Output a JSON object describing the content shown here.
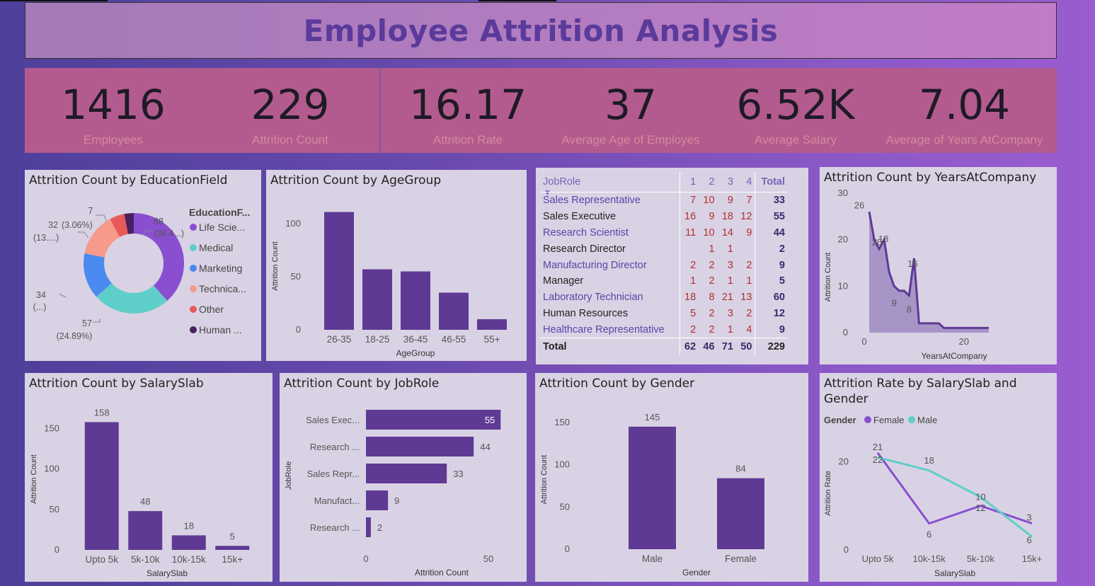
{
  "title": "Employee Attrition Analysis",
  "kpis": [
    {
      "value": "1416",
      "label": "Employees"
    },
    {
      "value": "229",
      "label": "Attrition Count"
    },
    {
      "value": "16.17",
      "label": "Attrition Rate"
    },
    {
      "value": "37",
      "label": "Average Age of Employes"
    },
    {
      "value": "6.52K",
      "label": "Average Salary"
    },
    {
      "value": "7.04",
      "label": "Average of Years AtCompany"
    }
  ],
  "colors": {
    "primary": "#5e3a94",
    "panel_bg": "#d9d2e4",
    "kpi_bg": "#b35b8e",
    "teal": "#5ecfc8",
    "violet": "#8a4fd0"
  },
  "panels": {
    "education": {
      "title": "Attrition Count by EducationField",
      "legend_title": "EducationF..."
    },
    "agegroup": {
      "title": "Attrition Count by AgeGroup"
    },
    "years": {
      "title": "Attrition Count by YearsAtCompany"
    },
    "salaryslab": {
      "title": "Attrition Count by SalarySlab"
    },
    "jobrole": {
      "title": "Attrition Count by JobRole"
    },
    "gender": {
      "title": "Attrition Count by Gender"
    },
    "rate": {
      "title_line1": "Attrition Rate by SalarySlab and",
      "title_line2": "Gender",
      "legend_title": "Gender"
    }
  },
  "matrix": {
    "headers": [
      "JobRole",
      "1",
      "2",
      "3",
      "4",
      "Total"
    ],
    "rows": [
      {
        "role": "Sales Representative",
        "c1": "7",
        "c2": "10",
        "c3": "9",
        "c4": "7",
        "total": "33"
      },
      {
        "role": "Sales Executive",
        "c1": "16",
        "c2": "9",
        "c3": "18",
        "c4": "12",
        "total": "55"
      },
      {
        "role": "Research Scientist",
        "c1": "11",
        "c2": "10",
        "c3": "14",
        "c4": "9",
        "total": "44"
      },
      {
        "role": "Research Director",
        "c1": "",
        "c2": "1",
        "c3": "1",
        "c4": "",
        "total": "2"
      },
      {
        "role": "Manufacturing Director",
        "c1": "2",
        "c2": "2",
        "c3": "3",
        "c4": "2",
        "total": "9"
      },
      {
        "role": "Manager",
        "c1": "1",
        "c2": "2",
        "c3": "1",
        "c4": "1",
        "total": "5"
      },
      {
        "role": "Laboratory Technician",
        "c1": "18",
        "c2": "8",
        "c3": "21",
        "c4": "13",
        "total": "60"
      },
      {
        "role": "Human Resources",
        "c1": "5",
        "c2": "2",
        "c3": "3",
        "c4": "2",
        "total": "12"
      },
      {
        "role": "Healthcare Representative",
        "c1": "2",
        "c2": "2",
        "c3": "1",
        "c4": "4",
        "total": "9"
      }
    ],
    "total_row": {
      "role": "Total",
      "c1": "62",
      "c2": "46",
      "c3": "71",
      "c4": "50",
      "total": "229"
    }
  },
  "chart_data": [
    {
      "type": "pie",
      "title": "Attrition Count by EducationField",
      "legend_title": "EducationF...",
      "slices": [
        {
          "name": "Life Scie...",
          "value": 88,
          "label": "88",
          "sublabel": "(38.4...)",
          "color": "#8a4fd0"
        },
        {
          "name": "Medical",
          "value": 57,
          "label": "57",
          "sublabel": "(24.89%)",
          "color": "#5ecfc8"
        },
        {
          "name": "Marketing",
          "value": 34,
          "label": "34",
          "sublabel": "(...)",
          "color": "#4a8af0"
        },
        {
          "name": "Technica...",
          "value": 32,
          "label": "32",
          "sublabel": "(13....)",
          "color": "#f69a8a"
        },
        {
          "name": "Other",
          "value": 11,
          "label": "",
          "sublabel": "",
          "color": "#e85a5a"
        },
        {
          "name": "Human ...",
          "value": 7,
          "label": "7",
          "sublabel": "(3.06%)",
          "color": "#4a2060"
        }
      ]
    },
    {
      "type": "bar",
      "title": "Attrition Count by AgeGroup",
      "categories": [
        "26-35",
        "18-25",
        "36-45",
        "46-55",
        "55+"
      ],
      "values": [
        111,
        57,
        55,
        35,
        10
      ],
      "xlabel": "AgeGroup",
      "ylabel": "Attrition Count",
      "yticks": [
        0,
        50,
        100
      ],
      "ylim": [
        0,
        120
      ]
    },
    {
      "type": "area",
      "title": "Attrition Count by YearsAtCompany",
      "x": [
        1,
        2,
        3,
        4,
        5,
        6,
        7,
        8,
        9,
        10,
        11,
        12,
        13,
        14,
        15,
        16,
        17,
        18,
        19,
        20,
        21,
        22,
        23,
        24,
        25
      ],
      "values": [
        26,
        20,
        18,
        20,
        13,
        10,
        9,
        9,
        8,
        16,
        2,
        2,
        2,
        2,
        2,
        1,
        1,
        1,
        1,
        1,
        1,
        1,
        1,
        1,
        1
      ],
      "point_labels": [
        "26",
        "18",
        "20",
        "16",
        "9",
        "8"
      ],
      "xlabel": "YearsAtCompany",
      "ylabel": "Attrition Count",
      "xticks": [
        0,
        20
      ],
      "yticks": [
        0,
        10,
        20,
        30
      ],
      "xlim": [
        0,
        27
      ],
      "ylim": [
        0,
        30
      ]
    },
    {
      "type": "bar",
      "title": "Attrition Count by SalarySlab",
      "categories": [
        "Upto 5k",
        "5k-10k",
        "10k-15k",
        "15k+"
      ],
      "values": [
        158,
        48,
        18,
        5
      ],
      "xlabel": "SalarySlab",
      "ylabel": "Attrition Count",
      "yticks": [
        0,
        50,
        100,
        150
      ],
      "ylim": [
        0,
        175
      ]
    },
    {
      "type": "bar",
      "orientation": "horizontal",
      "title": "Attrition Count by JobRole",
      "categories": [
        "Sales Exec...",
        "Research ...",
        "Sales Repr...",
        "Manufact...",
        "Research ..."
      ],
      "values": [
        55,
        44,
        33,
        9,
        2
      ],
      "xlabel": "Attrition Count",
      "ylabel": "JobRole",
      "xticks": [
        0,
        50
      ],
      "xlim": [
        0,
        60
      ]
    },
    {
      "type": "bar",
      "title": "Attrition Count by Gender",
      "categories": [
        "Male",
        "Female"
      ],
      "values": [
        145,
        84
      ],
      "xlabel": "Gender",
      "ylabel": "Attrition Count",
      "yticks": [
        0,
        50,
        100,
        150
      ],
      "ylim": [
        0,
        165
      ]
    },
    {
      "type": "line",
      "title": "Attrition Rate by SalarySlab and Gender",
      "categories": [
        "Upto 5k",
        "10k-15k",
        "5k-10k",
        "15k+"
      ],
      "series": [
        {
          "name": "Female",
          "values": [
            22,
            6,
            10,
            6
          ],
          "labels": [
            "22",
            "6",
            "10",
            "3"
          ],
          "color": "#8a4fd0"
        },
        {
          "name": "Male",
          "values": [
            21,
            18,
            12,
            3
          ],
          "labels": [
            "21",
            "18",
            "12",
            "6"
          ],
          "color": "#5ecfc8"
        }
      ],
      "xlabel": "SalarySlab",
      "ylabel": "Attrition Rate",
      "yticks": [
        0,
        20
      ],
      "ylim": [
        0,
        26
      ]
    }
  ]
}
